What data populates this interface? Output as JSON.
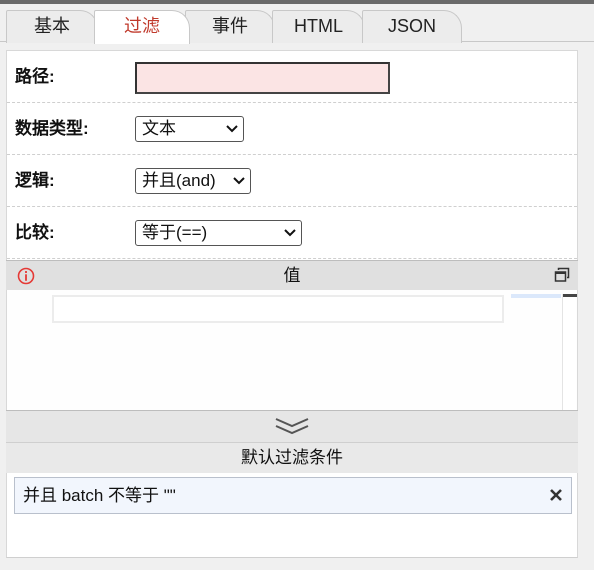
{
  "tabs": [
    {
      "label": "基本",
      "active": false
    },
    {
      "label": "过滤",
      "active": true
    },
    {
      "label": "事件",
      "active": false
    },
    {
      "label": "HTML",
      "active": false
    },
    {
      "label": "JSON",
      "active": false
    }
  ],
  "form": {
    "path_label": "路径:",
    "path_value": "",
    "data_type_label": "数据类型:",
    "data_type_value": "文本",
    "logic_label": "逻辑:",
    "logic_value": "并且(and)",
    "compare_label": "比较:",
    "compare_value": "等于(==)"
  },
  "value_section": {
    "title": "值",
    "editor_value": ""
  },
  "default_filter": {
    "title": "默认过滤条件",
    "conditions": [
      {
        "text": "并且 batch 不等于 \"\""
      }
    ]
  },
  "colors": {
    "active_tab_text": "#c0392b",
    "path_input_bg": "#fbe4e4",
    "info_icon": "#e53935",
    "condition_bg": "#f2f6fd"
  },
  "icons": {
    "info": "info-icon",
    "restore": "restore-window-icon",
    "expand": "double-chevron-down-icon",
    "remove": "close-icon",
    "select_arrow": "chevron-down-icon"
  }
}
